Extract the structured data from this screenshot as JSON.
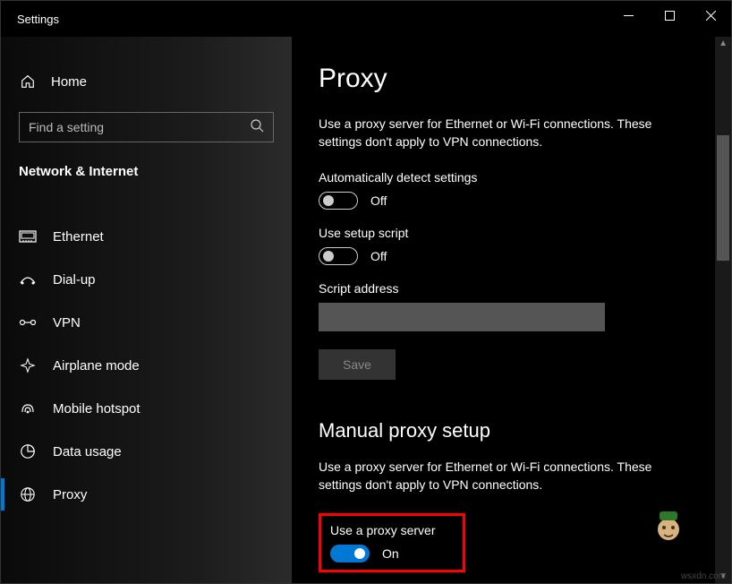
{
  "window_title": "Settings",
  "home_label": "Home",
  "search": {
    "placeholder": "Find a setting"
  },
  "category": "Network & Internet",
  "sidebar": {
    "items": [
      {
        "label": "Ethernet"
      },
      {
        "label": "Dial-up"
      },
      {
        "label": "VPN"
      },
      {
        "label": "Airplane mode"
      },
      {
        "label": "Mobile hotspot"
      },
      {
        "label": "Data usage"
      },
      {
        "label": "Proxy"
      }
    ]
  },
  "main": {
    "title": "Proxy",
    "desc1": "Use a proxy server for Ethernet or Wi-Fi connections. These settings don't apply to VPN connections.",
    "auto_label": "Automatically detect settings",
    "auto_state": "Off",
    "script_label": "Use setup script",
    "script_state": "Off",
    "script_addr_label": "Script address",
    "save_label": "Save",
    "manual_title": "Manual proxy setup",
    "desc2": "Use a proxy server for Ethernet or Wi-Fi connections. These settings don't apply to VPN connections.",
    "use_proxy_label": "Use a proxy server",
    "use_proxy_state": "On"
  },
  "watermark": "wsxdn.com"
}
